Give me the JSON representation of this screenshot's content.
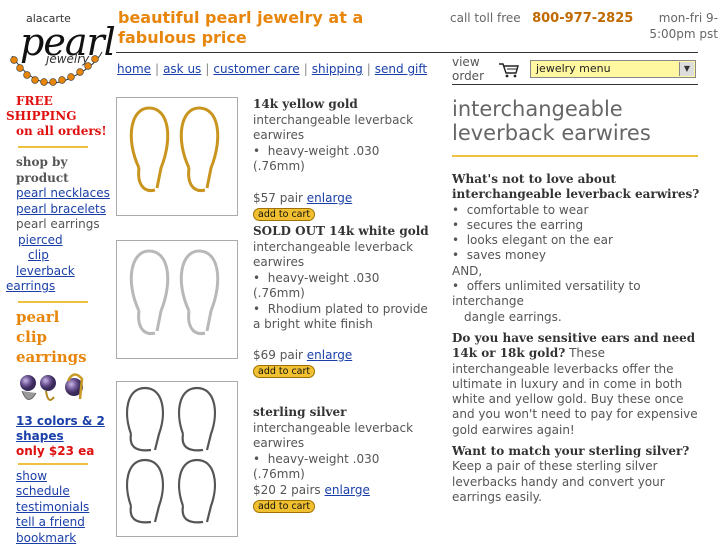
{
  "logo": {
    "line1": "alacarte",
    "line2": "pearl",
    "line3": "jewelry"
  },
  "header": {
    "tagline": "beautiful pearl jewelry at a fabulous price",
    "call_label": "call toll free",
    "phone": "800-977-2825",
    "hours": "mon-fri 9-5:00pm pst"
  },
  "topnav": [
    "home",
    "ask us",
    "customer care",
    "shipping",
    "send gift"
  ],
  "view_order": "view order",
  "menu_select": "jewelry menu",
  "sidebar": {
    "free_shipping": [
      "FREE",
      "SHIPPING",
      "on all orders!"
    ],
    "shop_by": "shop by product",
    "links": [
      "pearl necklaces",
      "pearl bracelets"
    ],
    "current": "pearl earrings",
    "sublinks": [
      "pierced",
      "clip",
      "leverback"
    ],
    "sublink_tail": "earrings",
    "clip_header": [
      "pearl",
      "clip",
      "earrings"
    ],
    "promo_link": "13 colors & 2 shapes",
    "promo_price": "only $23 ea",
    "bottom_links": [
      "show schedule",
      "testimonials",
      "tell a friend",
      "bookmark"
    ]
  },
  "products": [
    {
      "title": "14k yellow gold",
      "subtitle": "interchangeable leverback earwires",
      "bullets": [
        "heavy-weight .030 (.76mm)"
      ],
      "price": "$57 pair",
      "enlarge": "enlarge",
      "add": "add to cart"
    },
    {
      "title": "SOLD OUT 14k white gold",
      "subtitle": "interchangeable leverback earwires",
      "bullets": [
        "heavy-weight .030 (.76mm)",
        "Rhodium plated to provide a bright white finish"
      ],
      "price": "$69 pair",
      "enlarge": "enlarge",
      "add": "add to cart"
    },
    {
      "title": "sterling silver",
      "subtitle": "interchangeable leverback earwires",
      "bullets": [
        "heavy-weight .030 (.76mm)"
      ],
      "price": "$20 2 pairs",
      "enlarge": "enlarge",
      "add": "add to cart"
    }
  ],
  "right": {
    "title": "interchangeable leverback earwires",
    "q1": "What's not to love about interchangeable leverback earwires?",
    "q1_list": [
      "comfortable to wear",
      "secures the earring",
      "looks elegant on the ear",
      "saves money"
    ],
    "and": "AND,",
    "q1_extra": "offers unlimited versatility to interchange",
    "q1_extra2": "dangle earrings.",
    "q2": "Do you have sensitive ears and need 14k or 18k gold?",
    "q2_body": "These interchangeable leverbacks offer the ultimate in luxury and in come in both white and yellow gold. Buy these once and you won't need to pay for expensive gold earwires again!",
    "q3": "Want to match your sterling silver?",
    "q3_body": "Keep a pair of these sterling silver leverbacks handy and convert your earrings easily."
  },
  "colors": {
    "accent": "#e8860c",
    "link": "#1a3fa8",
    "rule": "#f0c040",
    "free": "#e01010"
  }
}
